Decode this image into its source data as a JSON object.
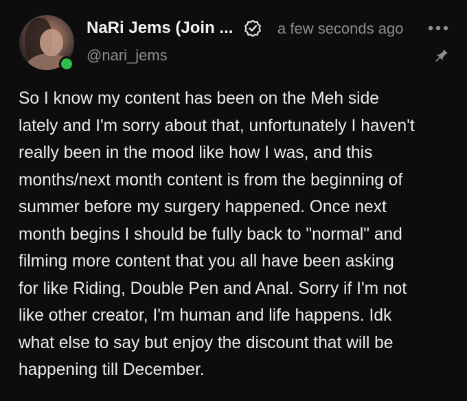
{
  "author": {
    "display_name": "NaRi Jems (Join ...",
    "handle": "@nari_jems",
    "online_status": "online",
    "verified_icon": "verified-badge-icon"
  },
  "post": {
    "timestamp": "a few seconds ago",
    "more_icon": "more-horizontal-icon",
    "pin_icon": "pin-icon",
    "lines": [
      "So I know my content has been on the Meh side",
      "lately and I'm sorry about that, unfortunately I haven't",
      "really been in the mood like how I was, and this",
      "months/next month content is from the beginning of",
      "summer before my surgery happened. Once next",
      "month begins I should be fully back to \"normal\" and",
      "filming more content that you all have been asking",
      "for like Riding, Double Pen and Anal. Sorry if I'm not",
      "like other creator, I'm human and life happens. Idk",
      "what else to say but enjoy the discount that will be",
      "happening till December."
    ]
  },
  "colors": {
    "background": "#0d0d0e",
    "text": "#ececec",
    "muted": "#8d8d92",
    "online": "#2fbf4d"
  }
}
